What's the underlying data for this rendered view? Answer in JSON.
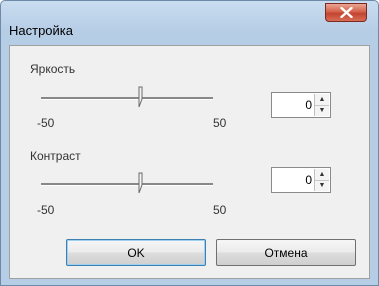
{
  "window": {
    "title": "Настройка",
    "close_icon": "close-icon"
  },
  "brightness": {
    "label": "Яркость",
    "min_label": "-50",
    "max_label": "50",
    "value": "0"
  },
  "contrast": {
    "label": "Контраст",
    "min_label": "-50",
    "max_label": "50",
    "value": "0"
  },
  "buttons": {
    "ok": "OK",
    "cancel": "Отмена"
  },
  "colors": {
    "title_bar": "#b6cde6",
    "close_button": "#c94a35",
    "client_bg": "#f0f0f0"
  }
}
